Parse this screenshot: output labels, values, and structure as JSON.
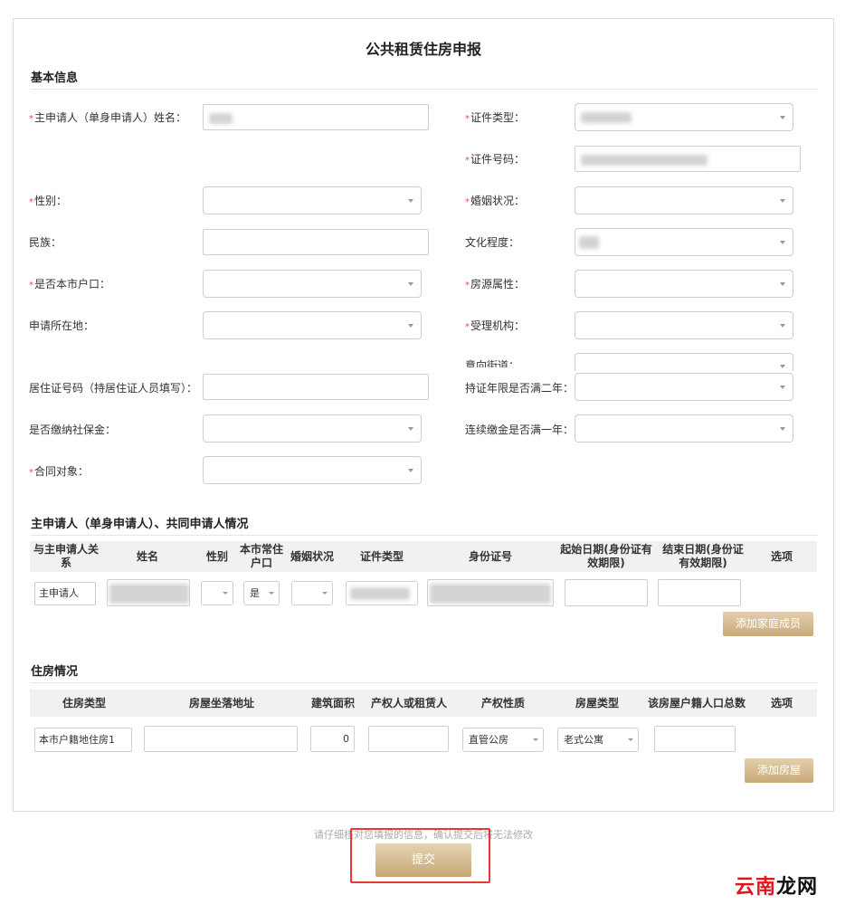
{
  "page_title": "公共租赁住房申报",
  "basic": {
    "title": "基本信息",
    "req_mark": "*",
    "fields": {
      "name_label": "主申请人（单身申请人）姓名：",
      "id_type_label": "证件类型：",
      "id_no_label": "证件号码：",
      "gender_label": "性别：",
      "marital_label": "婚姻状况：",
      "ethnicity_label": "民族：",
      "education_label": "文化程度：",
      "local_hukou_label": "是否本市户口：",
      "housing_attr_label": "房源属性：",
      "location_label": "申请所在地：",
      "agency_label": "受理机构：",
      "street_label": "意向街道：",
      "residence_permit_label": "居住证号码（持居住证人员填写）：",
      "permit_two_years_label": "持证年限是否满二年：",
      "social_security_label": "是否缴纳社保金：",
      "fund_one_year_label": "连续缴金是否满一年：",
      "contract_label": "合同对象："
    }
  },
  "family": {
    "title": "主申请人（单身申请人）、共同申请人情况",
    "headers": [
      "与主申请人关系",
      "姓名",
      "性别",
      "本市常住户口",
      "婚姻状况",
      "证件类型",
      "身份证号",
      "起始日期(身份证有效期限)",
      "结束日期(身份证有效期限)",
      "选项"
    ],
    "row": {
      "relation": "主申请人",
      "hukou": "是"
    },
    "add_button": "添加家庭成员"
  },
  "housing": {
    "title": "住房情况",
    "headers": [
      "住房类型",
      "房屋坐落地址",
      "建筑面积",
      "产权人或租赁人",
      "产权性质",
      "房屋类型",
      "该房屋户籍人口总数",
      "选项"
    ],
    "row": {
      "type": "本市户籍地住房1",
      "area": "0",
      "property_nature": "直管公房",
      "house_type": "老式公寓"
    },
    "add_button": "添加房屋"
  },
  "footer": {
    "hint": "请仔细核对您填报的信息，确认提交后将无法修改",
    "submit": "提交"
  },
  "watermark": {
    "part1": "云南",
    "part2": "龙网"
  },
  "colors": {
    "required": "#d9534f",
    "gold_button": "#c9aa79",
    "highlight_box": "#e53935",
    "watermark_red": "#e0161e"
  }
}
